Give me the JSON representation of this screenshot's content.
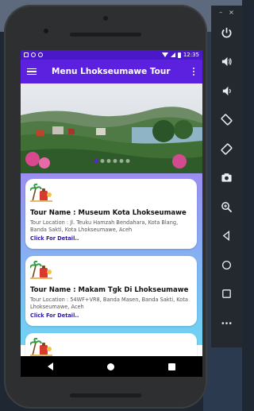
{
  "statusbar": {
    "time": "12:35"
  },
  "appbar": {
    "title": "Menu Lhokseumawe Tour",
    "menu_icon": "hamburger-icon",
    "overflow_icon": "kebab-icon"
  },
  "banner": {
    "slides": 6,
    "active_slide": 1
  },
  "cards": [
    {
      "name": "Tour Name : Museum Kota Lhokseumawe",
      "location": "Tour Location : Jl. Teuku Hamzah Bendahara, Kota Blang, Banda Sakti, Kota Lhokseumawe, Aceh",
      "link": "Click For Detail.."
    },
    {
      "name": "Tour Name : Makam Tgk Di Lhokseumawe",
      "location": "Tour Location : 54WF+VR8, Banda Masen, Banda Sakti, Kota Lhokseumawe, Aceh",
      "link": "Click For Detail.."
    }
  ],
  "emulator": {
    "window_controls": [
      "–",
      "×"
    ],
    "buttons": [
      "power",
      "volume-up",
      "volume-down",
      "rotate-left",
      "rotate-right",
      "camera",
      "zoom",
      "back",
      "home",
      "overview",
      "more"
    ]
  },
  "colors": {
    "appbar": "#5b21de",
    "statusbar": "#4a18c9",
    "link": "#2a1aa8"
  }
}
